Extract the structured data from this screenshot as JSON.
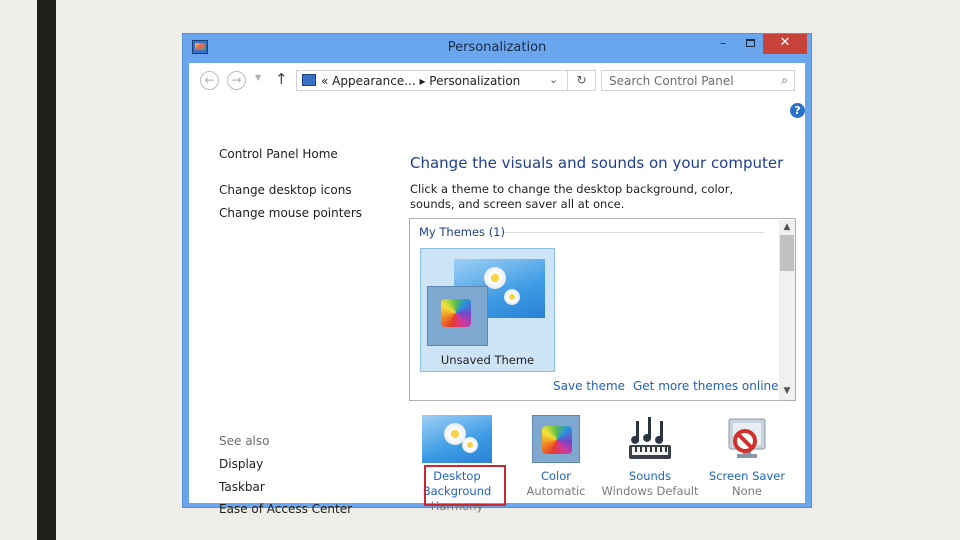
{
  "window": {
    "title": "Personalization",
    "minimize_glyph": "–",
    "close_glyph": "✕"
  },
  "nav": {
    "back_glyph": "←",
    "forward_glyph": "→",
    "dropdown_glyph": "▼",
    "up_glyph": "↑",
    "address": "« Appearance... ▸ Personalization",
    "address_chevron": "⌄",
    "refresh_glyph": "↻",
    "search_placeholder": "Search Control Panel",
    "search_glyph": "⌕"
  },
  "help_glyph": "?",
  "left_pane": {
    "home": "Control Panel Home",
    "links": [
      "Change desktop icons",
      "Change mouse pointers"
    ],
    "see_also_label": "See also",
    "see_also": [
      "Display",
      "Taskbar",
      "Ease of Access Center"
    ]
  },
  "main": {
    "heading": "Change the visuals and sounds on your computer",
    "description": "Click a theme to change the desktop background, color, sounds, and screen saver all at once.",
    "group_label": "My Themes (1)",
    "theme_name": "Unsaved Theme",
    "save_theme": "Save theme",
    "more_themes": "Get more themes online",
    "scroll_up": "▲",
    "scroll_down": "▼"
  },
  "bottom": {
    "desktop_label": "Desktop Background",
    "desktop_value": "Harmony",
    "color_label": "Color",
    "color_value": "Automatic",
    "sounds_label": "Sounds",
    "sounds_value": "Windows Default",
    "saver_label": "Screen Saver",
    "saver_value": "None"
  },
  "colors": {
    "window_frame": "#6aa6ee",
    "close_button": "#c74238",
    "link": "#2263c0",
    "heading": "#1e3f8f",
    "highlight_box": "#c8282e",
    "theme_selected": "#cde4f7"
  }
}
